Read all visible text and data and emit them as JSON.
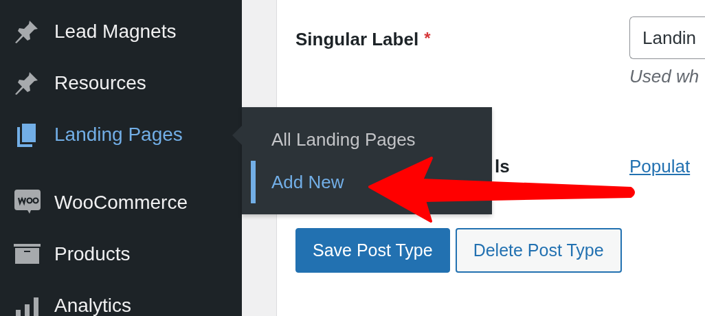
{
  "sidebar": {
    "items": [
      {
        "label": "Lead Magnets",
        "current": false
      },
      {
        "label": "Resources",
        "current": false
      },
      {
        "label": "Landing Pages",
        "current": true
      },
      {
        "label": "WooCommerce",
        "current": false
      },
      {
        "label": "Products",
        "current": false
      },
      {
        "label": "Analytics",
        "current": false
      }
    ]
  },
  "flyout": {
    "items": [
      {
        "label": "All Landing Pages",
        "selected": false
      },
      {
        "label": "Add New",
        "selected": true
      }
    ]
  },
  "form": {
    "singular_label": {
      "label": "Singular Label",
      "required_mark": "*",
      "value": "Landin",
      "description": "Used wh"
    },
    "hidden_row": {
      "label": "ls",
      "link": "Populat"
    },
    "buttons": [
      {
        "label": "Save Post Type",
        "kind": "primary"
      },
      {
        "label": "Delete Post Type",
        "kind": "secondary"
      }
    ]
  }
}
